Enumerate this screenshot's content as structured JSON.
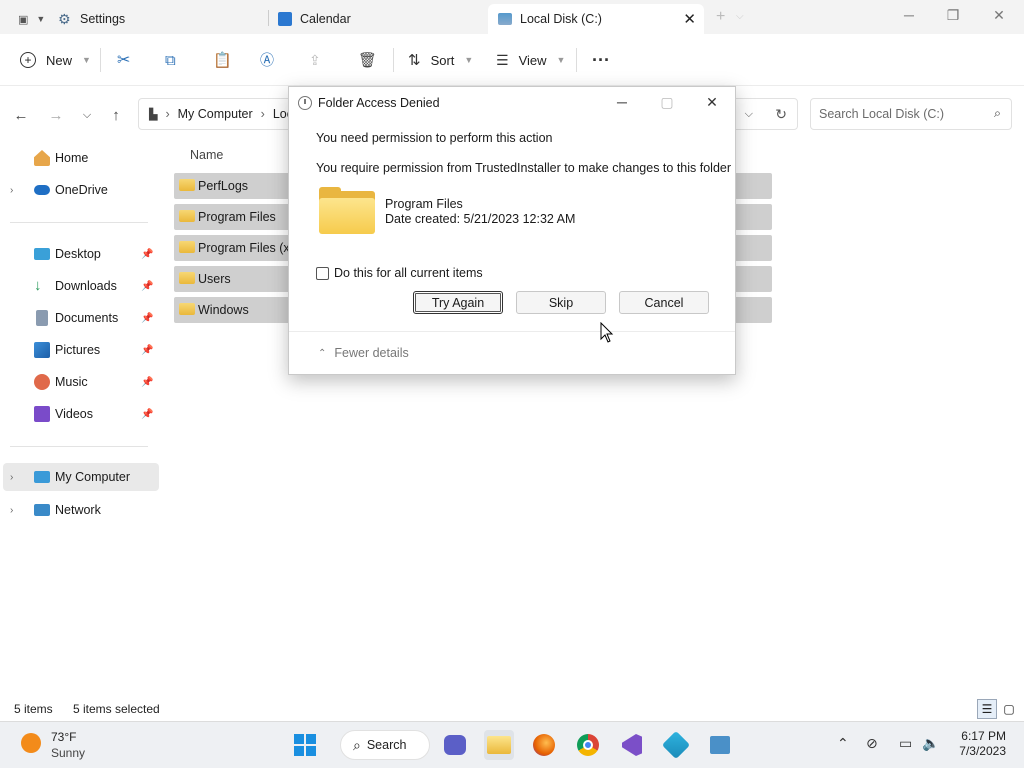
{
  "tabs": [
    {
      "label": "Settings"
    },
    {
      "label": "Calendar"
    },
    {
      "label": "Local Disk (C:)"
    }
  ],
  "toolbar": {
    "new_label": "New",
    "sort_label": "Sort",
    "view_label": "View"
  },
  "address": {
    "crumb1": "My Computer",
    "crumb2": "Loc"
  },
  "search": {
    "placeholder": "Search Local Disk (C:)"
  },
  "sidebar": {
    "items": [
      {
        "label": "Home"
      },
      {
        "label": "OneDrive"
      },
      {
        "label": "Desktop"
      },
      {
        "label": "Downloads"
      },
      {
        "label": "Documents"
      },
      {
        "label": "Pictures"
      },
      {
        "label": "Music"
      },
      {
        "label": "Videos"
      },
      {
        "label": "My Computer"
      },
      {
        "label": "Network"
      }
    ]
  },
  "content": {
    "column_name": "Name",
    "files": [
      {
        "name": "PerfLogs"
      },
      {
        "name": "Program Files"
      },
      {
        "name": "Program Files (x8"
      },
      {
        "name": "Users"
      },
      {
        "name": "Windows"
      }
    ]
  },
  "status": {
    "count": "5 items",
    "selected": "5 items selected"
  },
  "dialog": {
    "title": "Folder Access Denied",
    "message1": "You need permission to perform this action",
    "message2": "You require permission from TrustedInstaller to make changes to this folder",
    "item_name": "Program Files",
    "item_date": "Date created: 5/21/2023 12:32 AM",
    "checkbox_label": "Do this for all current items",
    "try_again": "Try Again",
    "skip": "Skip",
    "cancel": "Cancel",
    "fewer_details": "Fewer details"
  },
  "taskbar": {
    "temp": "73°F",
    "weather": "Sunny",
    "search_label": "Search",
    "time": "6:17 PM",
    "date": "7/3/2023"
  },
  "colors": {
    "accent": "#0067c0",
    "folder": "#f6cb4c",
    "selection": "#cfcfcf"
  }
}
